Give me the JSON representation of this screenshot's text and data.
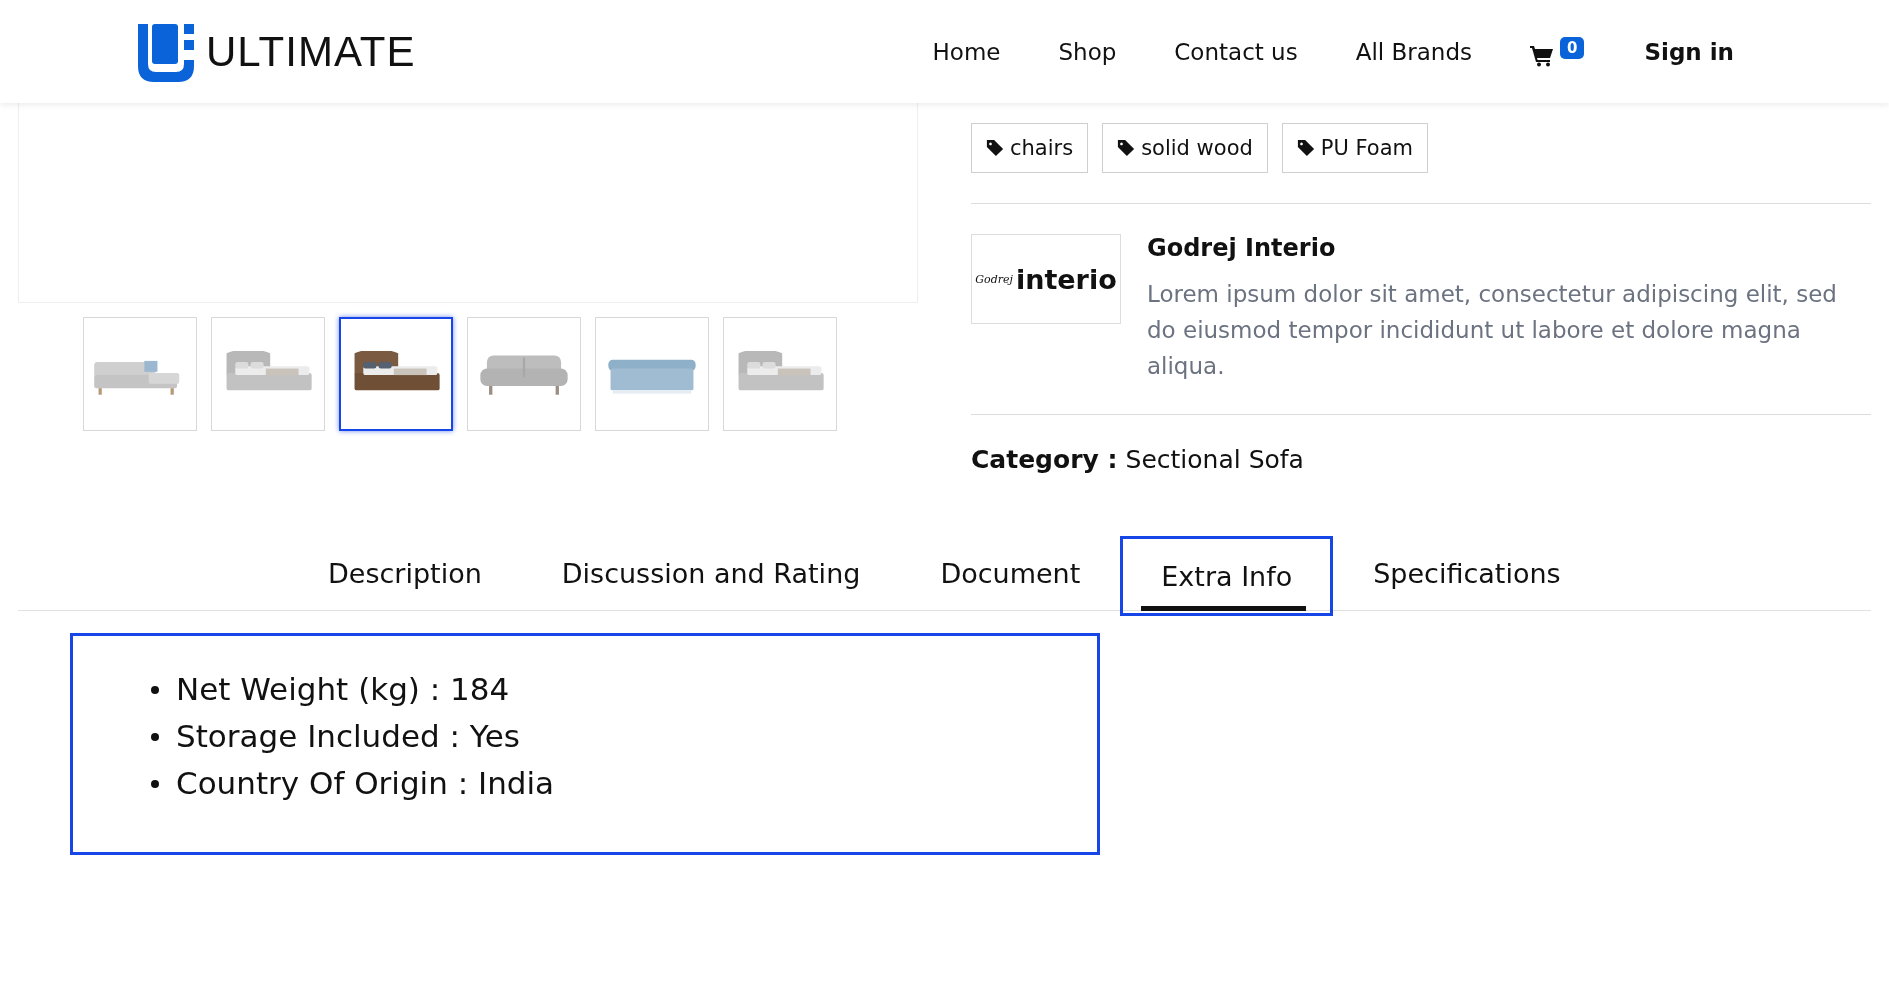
{
  "header": {
    "logo": "ULTIMATE",
    "nav": [
      {
        "label": "Home"
      },
      {
        "label": "Shop"
      },
      {
        "label": "Contact us"
      },
      {
        "label": "All Brands"
      }
    ],
    "cart_count": "0",
    "sign_in": "Sign in"
  },
  "gallery": {
    "thumbnails": [
      {
        "kind": "picture",
        "selected": false
      },
      {
        "kind": "picture",
        "selected": false
      },
      {
        "kind": "picture",
        "selected": true
      },
      {
        "kind": "picture",
        "selected": false
      },
      {
        "kind": "picture",
        "selected": false
      },
      {
        "kind": "picture",
        "selected": false
      }
    ]
  },
  "tags": [
    "chairs",
    "solid wood",
    "PU Foam"
  ],
  "brand": {
    "logo_script": "Godrej",
    "logo_word": "interio",
    "name": "Godrej Interio",
    "description": "Lorem ipsum dolor sit amet, consectetur adipiscing elit, sed do eiusmod tempor incididunt ut labore et dolore magna aliqua."
  },
  "category": {
    "label": "Category :",
    "value": "Sectional Sofa"
  },
  "tabs": [
    {
      "label": "Description",
      "selected": false
    },
    {
      "label": "Discussion and Rating",
      "selected": false
    },
    {
      "label": "Document",
      "selected": false
    },
    {
      "label": "Extra Info",
      "selected": true
    },
    {
      "label": "Specifications",
      "selected": false
    }
  ],
  "extra_info": [
    "Net Weight (kg) : 184",
    "Storage Included : Yes",
    "Country Of Origin : India"
  ]
}
